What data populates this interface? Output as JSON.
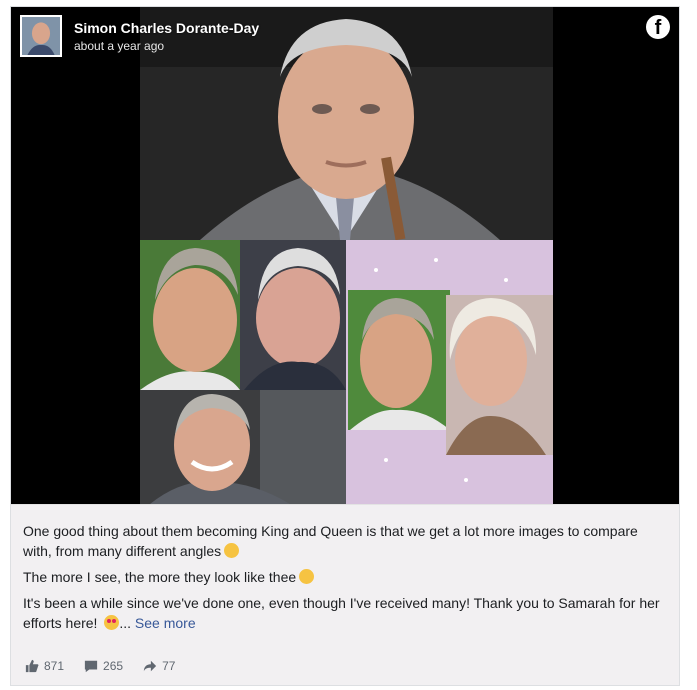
{
  "post": {
    "author": "Simon Charles Dorante-Day",
    "timestamp": "about a year ago",
    "paragraphs": [
      "One good thing about them becoming King and Queen is that we get a lot more images to compare with, from many different angles",
      "The more I see, the more they look like thee",
      "It's been a while since we've done one, even though I've received many! Thank you to Samarah for her efforts here!"
    ],
    "see_more_prefix": "...",
    "see_more_label": "See more"
  },
  "stats": {
    "likes": "871",
    "comments": "265",
    "shares": "77"
  },
  "icons": {
    "platform": "facebook-icon",
    "like": "thumbs-up-icon",
    "comment": "comment-icon",
    "share": "share-arrow-icon"
  },
  "colors": {
    "link": "#385898",
    "text": "#1c1e21",
    "muted": "#606770",
    "card_bg": "#f2f0f2"
  }
}
